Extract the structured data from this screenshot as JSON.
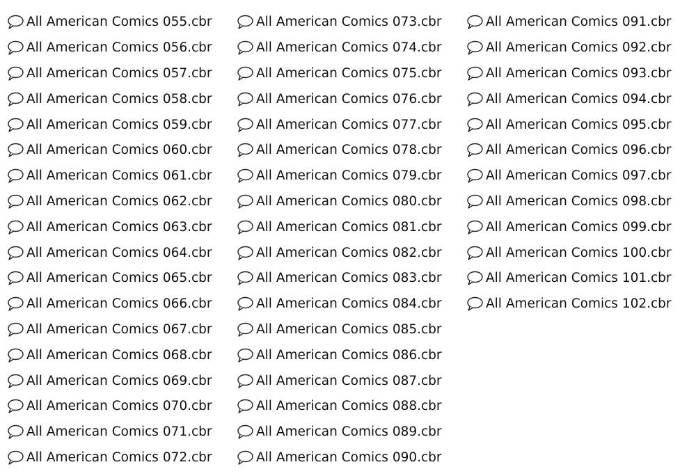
{
  "file_list": {
    "icon": "speech-bubble-file-icon",
    "columns": [
      {
        "items": [
          "All American Comics 055.cbr",
          "All American Comics 056.cbr",
          "All American Comics 057.cbr",
          "All American Comics 058.cbr",
          "All American Comics 059.cbr",
          "All American Comics 060.cbr",
          "All American Comics 061.cbr",
          "All American Comics 062.cbr",
          "All American Comics 063.cbr",
          "All American Comics 064.cbr",
          "All American Comics 065.cbr",
          "All American Comics 066.cbr",
          "All American Comics 067.cbr",
          "All American Comics 068.cbr",
          "All American Comics 069.cbr",
          "All American Comics 070.cbr",
          "All American Comics 071.cbr",
          "All American Comics 072.cbr"
        ]
      },
      {
        "items": [
          "All American Comics 073.cbr",
          "All American Comics 074.cbr",
          "All American Comics 075.cbr",
          "All American Comics 076.cbr",
          "All American Comics 077.cbr",
          "All American Comics 078.cbr",
          "All American Comics 079.cbr",
          "All American Comics 080.cbr",
          "All American Comics 081.cbr",
          "All American Comics 082.cbr",
          "All American Comics 083.cbr",
          "All American Comics 084.cbr",
          "All American Comics 085.cbr",
          "All American Comics 086.cbr",
          "All American Comics 087.cbr",
          "All American Comics 088.cbr",
          "All American Comics 089.cbr",
          "All American Comics 090.cbr"
        ]
      },
      {
        "items": [
          "All American Comics 091.cbr",
          "All American Comics 092.cbr",
          "All American Comics 093.cbr",
          "All American Comics 094.cbr",
          "All American Comics 095.cbr",
          "All American Comics 096.cbr",
          "All American Comics 097.cbr",
          "All American Comics 098.cbr",
          "All American Comics 099.cbr",
          "All American Comics 100.cbr",
          "All American Comics 101.cbr",
          "All American Comics 102.cbr"
        ]
      }
    ]
  }
}
